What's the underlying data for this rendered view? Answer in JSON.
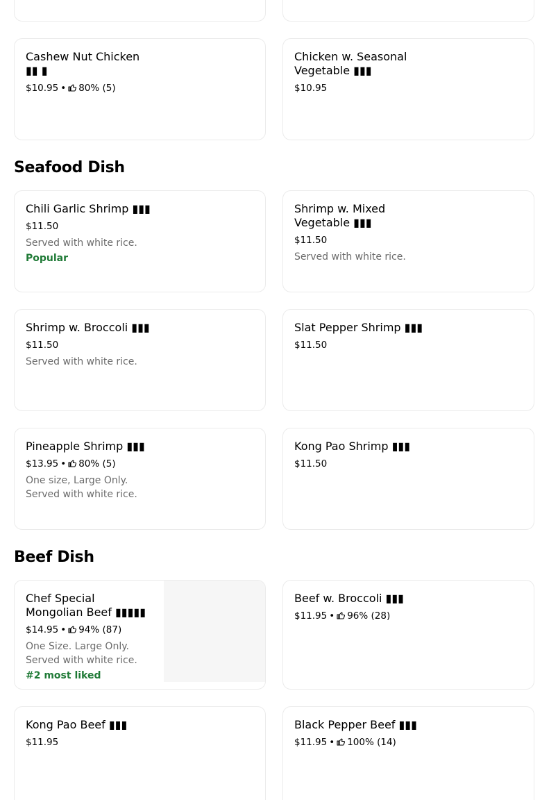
{
  "sections": {
    "seafood": {
      "title": "Seafood Dish"
    },
    "beef": {
      "title": "Beef Dish"
    }
  },
  "items": {
    "cashew_nut_chicken": {
      "name": "Cashew Nut Chicken ▮▮ ▮",
      "price": "$10.95",
      "rating": "80% (5)"
    },
    "chicken_seasonal_vegetable": {
      "name": "Chicken w. Seasonal Vegetable ▮▮▮",
      "price": "$10.95"
    },
    "chili_garlic_shrimp": {
      "name": "Chili Garlic Shrimp ▮▮▮",
      "price": "$11.50",
      "description": "Served with white rice.",
      "badge": "Popular"
    },
    "shrimp_mixed_vegetable": {
      "name": "Shrimp w. Mixed Vegetable ▮▮▮",
      "price": "$11.50",
      "description": "Served with white rice."
    },
    "shrimp_broccoli": {
      "name": "Shrimp w. Broccoli ▮▮▮",
      "price": "$11.50",
      "description": "Served with white rice."
    },
    "slat_pepper_shrimp": {
      "name": "Slat Pepper Shrimp ▮▮▮",
      "price": "$11.50"
    },
    "pineapple_shrimp": {
      "name": "Pineapple Shrimp ▮▮▮",
      "price": "$13.95",
      "rating": "80% (5)",
      "description": "One size, Large Only. Served with white rice."
    },
    "kong_pao_shrimp": {
      "name": "Kong Pao Shrimp ▮▮▮",
      "price": "$11.50"
    },
    "chef_special_mongolian_beef": {
      "name": "Chef Special Mongolian Beef ▮▮▮▮▮",
      "price": "$14.95",
      "rating": "94% (87)",
      "description": "One Size. Large Only. Served with white rice.",
      "badge": "#2 most liked"
    },
    "beef_broccoli": {
      "name": "Beef w. Broccoli ▮▮▮",
      "price": "$11.95",
      "rating": "96% (28)"
    },
    "kong_pao_beef": {
      "name": "Kong Pao Beef ▮▮▮",
      "price": "$11.95"
    },
    "black_pepper_beef": {
      "name": "Black Pepper Beef ▮▮▮",
      "price": "$11.95",
      "rating": "100% (14)"
    }
  },
  "separator": "•",
  "icons": {
    "rating": "thumbs-up-icon"
  },
  "colors": {
    "badge": "#1f7a36",
    "description": "#6b6b6b",
    "border": "#ebebeb"
  }
}
